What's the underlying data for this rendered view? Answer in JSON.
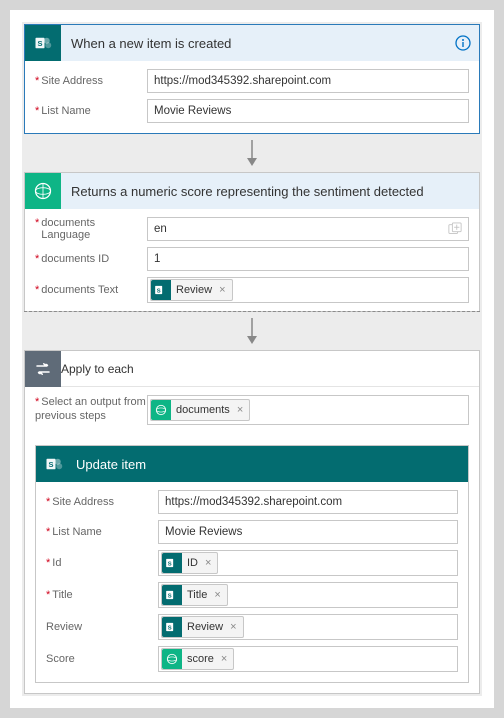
{
  "step1": {
    "title": "When a new item is created",
    "fields": {
      "site_label": "Site Address",
      "site_value": "https://mod345392.sharepoint.com",
      "list_label": "List Name",
      "list_value": "Movie Reviews"
    }
  },
  "step2": {
    "title": "Returns a numeric score representing the sentiment detected",
    "fields": {
      "lang_label": "documents Language",
      "lang_value": "en",
      "id_label": "documents ID",
      "id_value": "1",
      "text_label": "documents Text",
      "text_token": "Review"
    }
  },
  "step3": {
    "title": "Apply to each",
    "select_label": "Select an output from previous steps",
    "select_token": "documents"
  },
  "step4": {
    "title": "Update item",
    "fields": {
      "site_label": "Site Address",
      "site_value": "https://mod345392.sharepoint.com",
      "list_label": "List Name",
      "list_value": "Movie Reviews",
      "id_label": "Id",
      "id_token": "ID",
      "title_label": "Title",
      "title_token": "Title",
      "review_label": "Review",
      "review_token": "Review",
      "score_label": "Score",
      "score_token": "score"
    }
  },
  "token_x": "×"
}
